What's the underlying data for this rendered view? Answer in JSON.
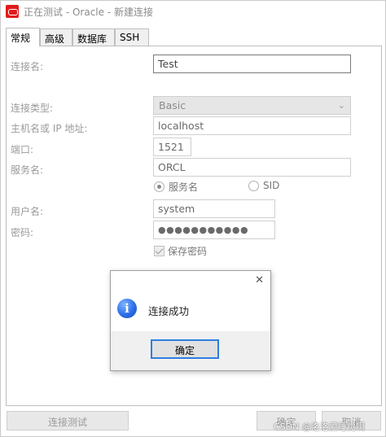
{
  "window": {
    "title": "正在测试 - Oracle - 新建连接",
    "accent_color": "#e21b1b"
  },
  "tabs": [
    {
      "label": "常规",
      "active": true
    },
    {
      "label": "高级",
      "active": false
    },
    {
      "label": "数据库",
      "active": false
    },
    {
      "label": "SSH",
      "active": false
    }
  ],
  "form": {
    "connection_name": {
      "label": "连接名:",
      "value": "Test"
    },
    "connection_type": {
      "label": "连接类型:",
      "value": "Basic"
    },
    "host": {
      "label": "主机名或 IP 地址:",
      "value": "localhost"
    },
    "port": {
      "label": "端口:",
      "value": "1521"
    },
    "service": {
      "label": "服务名:",
      "value": "ORCL"
    },
    "service_radio": {
      "option1": "服务名",
      "option2": "SID",
      "selected": "服务名"
    },
    "username": {
      "label": "用户名:",
      "value": "system"
    },
    "password": {
      "label": "密码:",
      "value": "●●●●●●●●●●●"
    },
    "save_password": {
      "label": "保存密码",
      "checked": true
    }
  },
  "footer": {
    "test_button": "连接测试",
    "ok_button": "确定",
    "cancel_button": "取消"
  },
  "dialog": {
    "message": "连接成功",
    "ok_label": "确定",
    "close_glyph": "✕",
    "icon_glyph": "i",
    "focus_color": "#2f7de1"
  },
  "watermark": "CSDN @洛洛爱睡觉啊"
}
